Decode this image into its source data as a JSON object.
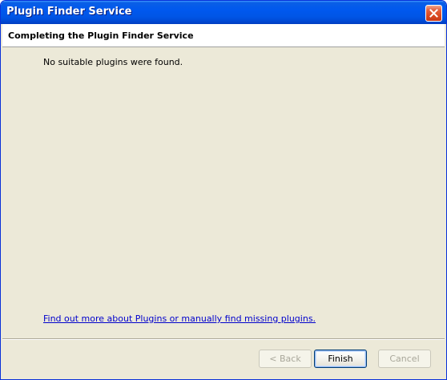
{
  "window": {
    "title": "Plugin Finder Service",
    "close_icon": "close-x-icon"
  },
  "header": {
    "title": "Completing the Plugin Finder Service"
  },
  "content": {
    "message": "No suitable plugins were found.",
    "link": "Find out more about Plugins or manually find missing plugins."
  },
  "buttons": {
    "back": "< Back",
    "finish": "Finish",
    "cancel": "Cancel"
  },
  "colors": {
    "titlebar": "#0055e5",
    "dialog_bg": "#ece9d8",
    "link": "#0000cc",
    "close_button": "#d8461f"
  }
}
